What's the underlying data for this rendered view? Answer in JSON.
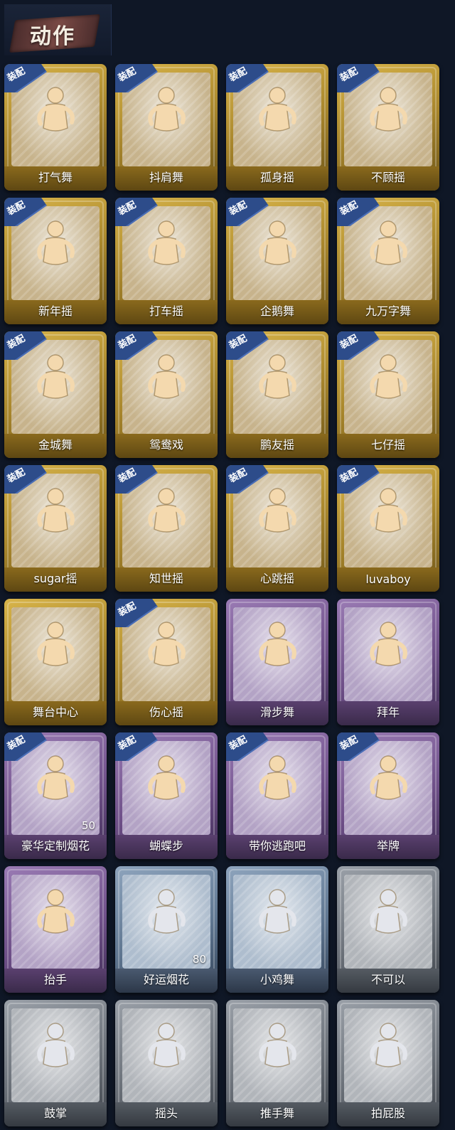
{
  "header": {
    "title": "动作"
  },
  "colors": {
    "gold": "#c9a43c",
    "purple": "#8a6aa6",
    "blue": "#7c92ac",
    "gray": "#888e96",
    "badge": "#2d4c8a",
    "figure_light": "#f4d9ae",
    "figure_silver": "#e4e6ec"
  },
  "badge_label": "装配",
  "items": [
    {
      "label": "打气舞",
      "rarity": "gold",
      "equipped": true,
      "count": "",
      "icon": "dancer-icon"
    },
    {
      "label": "抖肩舞",
      "rarity": "gold",
      "equipped": true,
      "count": "",
      "icon": "dancer-icon"
    },
    {
      "label": "孤身摇",
      "rarity": "gold",
      "equipped": true,
      "count": "",
      "icon": "dancer-icon"
    },
    {
      "label": "不顾摇",
      "rarity": "gold",
      "equipped": true,
      "count": "",
      "icon": "dancer-icon"
    },
    {
      "label": "新年摇",
      "rarity": "gold",
      "equipped": true,
      "count": "",
      "icon": "dancer-icon"
    },
    {
      "label": "打车摇",
      "rarity": "gold",
      "equipped": true,
      "count": "",
      "icon": "dancer-icon"
    },
    {
      "label": "企鹅舞",
      "rarity": "gold",
      "equipped": true,
      "count": "",
      "icon": "dancer-icon"
    },
    {
      "label": "九万字舞",
      "rarity": "gold",
      "equipped": true,
      "count": "",
      "icon": "dancer-icon"
    },
    {
      "label": "金城舞",
      "rarity": "gold",
      "equipped": true,
      "count": "",
      "icon": "dancer-icon"
    },
    {
      "label": "鸳鸯戏",
      "rarity": "gold",
      "equipped": true,
      "count": "",
      "icon": "dancer-icon"
    },
    {
      "label": "鹏友摇",
      "rarity": "gold",
      "equipped": true,
      "count": "",
      "icon": "dancer-icon"
    },
    {
      "label": "七仔摇",
      "rarity": "gold",
      "equipped": true,
      "count": "",
      "icon": "dancer-icon"
    },
    {
      "label": "sugar摇",
      "rarity": "gold",
      "equipped": true,
      "count": "",
      "icon": "dancer-icon"
    },
    {
      "label": "知世摇",
      "rarity": "gold",
      "equipped": true,
      "count": "",
      "icon": "dancer-icon"
    },
    {
      "label": "心跳摇",
      "rarity": "gold",
      "equipped": true,
      "count": "",
      "icon": "dancer-icon"
    },
    {
      "label": "luvaboy",
      "rarity": "gold",
      "equipped": true,
      "count": "",
      "icon": "dancer-icon"
    },
    {
      "label": "舞台中心",
      "rarity": "gold",
      "equipped": false,
      "count": "",
      "icon": "dancer-icon"
    },
    {
      "label": "伤心摇",
      "rarity": "gold",
      "equipped": true,
      "count": "",
      "icon": "heart-hands-icon"
    },
    {
      "label": "滑步舞",
      "rarity": "purple",
      "equipped": false,
      "count": "",
      "icon": "dancer-icon"
    },
    {
      "label": "拜年",
      "rarity": "purple",
      "equipped": false,
      "count": "",
      "icon": "bow-icon"
    },
    {
      "label": "豪华定制烟花",
      "rarity": "purple",
      "equipped": true,
      "count": "50",
      "icon": "fireworks-icon"
    },
    {
      "label": "蝴蝶步",
      "rarity": "purple",
      "equipped": true,
      "count": "",
      "icon": "dancer-icon"
    },
    {
      "label": "带你逃跑吧",
      "rarity": "purple",
      "equipped": true,
      "count": "",
      "icon": "dancer-icon"
    },
    {
      "label": "举牌",
      "rarity": "purple",
      "equipped": true,
      "count": "",
      "icon": "sign-icon"
    },
    {
      "label": "抬手",
      "rarity": "purple",
      "equipped": false,
      "count": "",
      "icon": "hand-icon"
    },
    {
      "label": "好运烟花",
      "rarity": "blue",
      "equipped": false,
      "count": "80",
      "icon": "firework-can-icon"
    },
    {
      "label": "小鸡舞",
      "rarity": "blue",
      "equipped": false,
      "count": "",
      "icon": "dancer-icon"
    },
    {
      "label": "不可以",
      "rarity": "gray",
      "equipped": false,
      "count": "",
      "icon": "finger-icon"
    },
    {
      "label": "鼓掌",
      "rarity": "gray",
      "equipped": false,
      "count": "",
      "icon": "clap-icon"
    },
    {
      "label": "摇头",
      "rarity": "gray",
      "equipped": false,
      "count": "",
      "icon": "dancer-icon"
    },
    {
      "label": "推手舞",
      "rarity": "gray",
      "equipped": false,
      "count": "",
      "icon": "dancer-icon"
    },
    {
      "label": "拍屁股",
      "rarity": "gray",
      "equipped": false,
      "count": "",
      "icon": "dancer-icon"
    }
  ]
}
